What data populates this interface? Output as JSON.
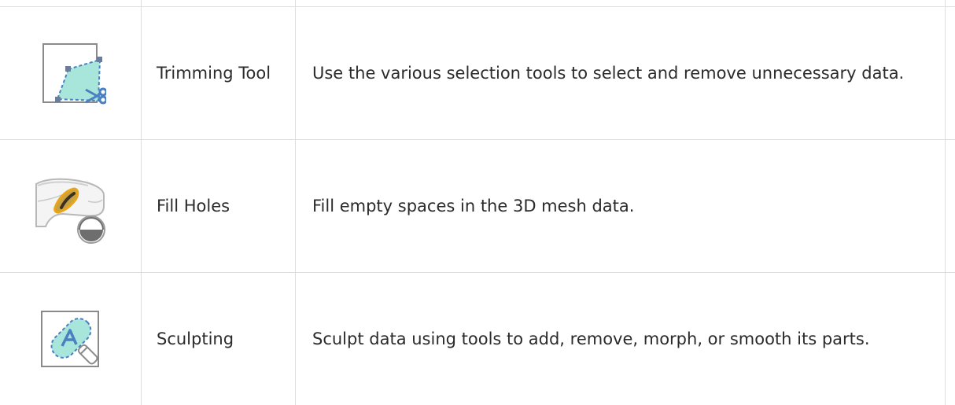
{
  "rows": [
    {
      "icon": "trimming-tool-icon",
      "name": "Trimming Tool",
      "description": "Use the various selection tools to select and remove unnecessary data."
    },
    {
      "icon": "fill-holes-icon",
      "name": "Fill Holes",
      "description": "Fill empty spaces in the 3D mesh data."
    },
    {
      "icon": "sculpting-icon",
      "name": "Sculpting",
      "description": "Sculpt data using tools to add, remove, morph, or smooth its parts."
    }
  ],
  "colors": {
    "border": "#dedede",
    "accent_fill": "#a8e6db",
    "accent_blue": "#4a7fc1",
    "handle": "#6b7d9c"
  }
}
